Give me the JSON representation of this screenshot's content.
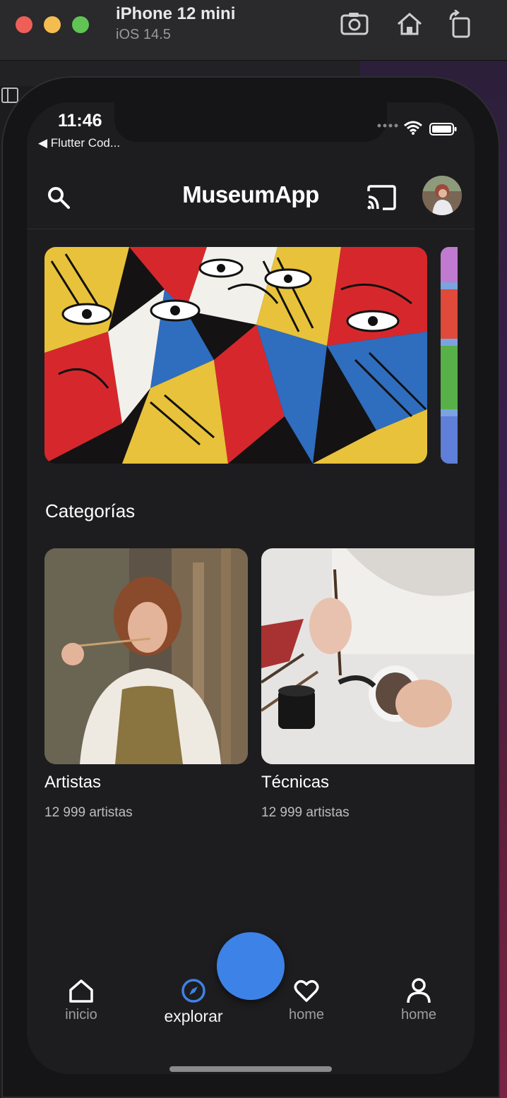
{
  "simulator": {
    "device_name": "iPhone 12 mini",
    "os_version": "iOS 14.5"
  },
  "status_bar": {
    "time": "11:46",
    "back_app": "◀ Flutter Cod..."
  },
  "appbar": {
    "title": "MuseumApp"
  },
  "categories": {
    "title": "Categorías",
    "items": [
      {
        "name": "Artistas",
        "count": "12 999 artistas"
      },
      {
        "name": "Técnicas",
        "count": "12 999 artistas"
      }
    ]
  },
  "bottom_nav": {
    "items": [
      {
        "label": "inicio",
        "icon": "home-icon"
      },
      {
        "label": "explorar",
        "icon": "compass-icon",
        "active": true
      },
      {
        "label": "home",
        "icon": "heart-icon"
      },
      {
        "label": "home",
        "icon": "person-icon"
      }
    ]
  },
  "colors": {
    "accent": "#3d82e6",
    "background": "#1d1d1f"
  }
}
